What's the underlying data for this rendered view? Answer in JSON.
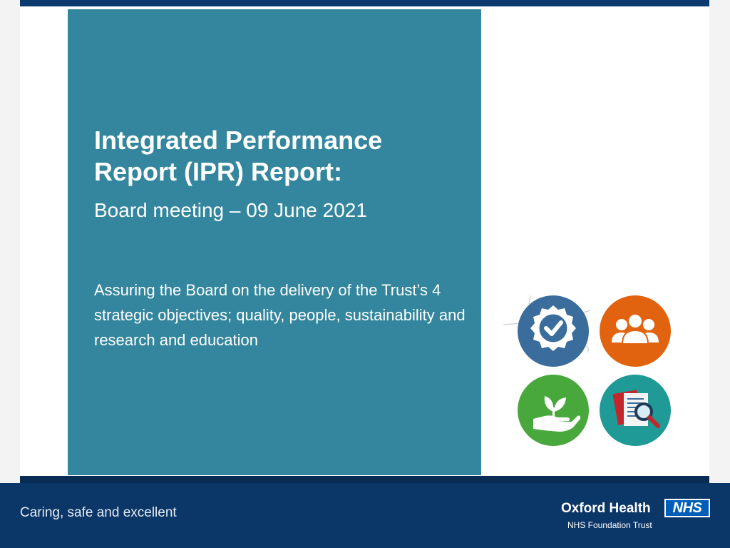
{
  "slide": {
    "title": "Integrated Performance Report (IPR) Report:",
    "subtitle": "Board meeting – 09 June 2021",
    "body": "Assuring the Board on the delivery of the Trust’s 4 strategic objectives; quality, people, sustainability and research and education"
  },
  "footer": {
    "tagline": "Caring, safe and excellent",
    "org_name": "Oxford Health",
    "org_sub": "NHS Foundation Trust",
    "nhs_logo": "NHS"
  },
  "icons": {
    "quality": "quality-badge-icon",
    "people": "people-group-icon",
    "sustainability": "plant-in-hand-icon",
    "research": "document-magnifier-icon"
  },
  "colors": {
    "panel": "#33869d",
    "navy": "#0b3668",
    "quality": "#3a6d9c",
    "people": "#e2630f",
    "sustainability": "#48a83c",
    "research": "#1f9a96",
    "nhs_blue": "#005eb8"
  }
}
